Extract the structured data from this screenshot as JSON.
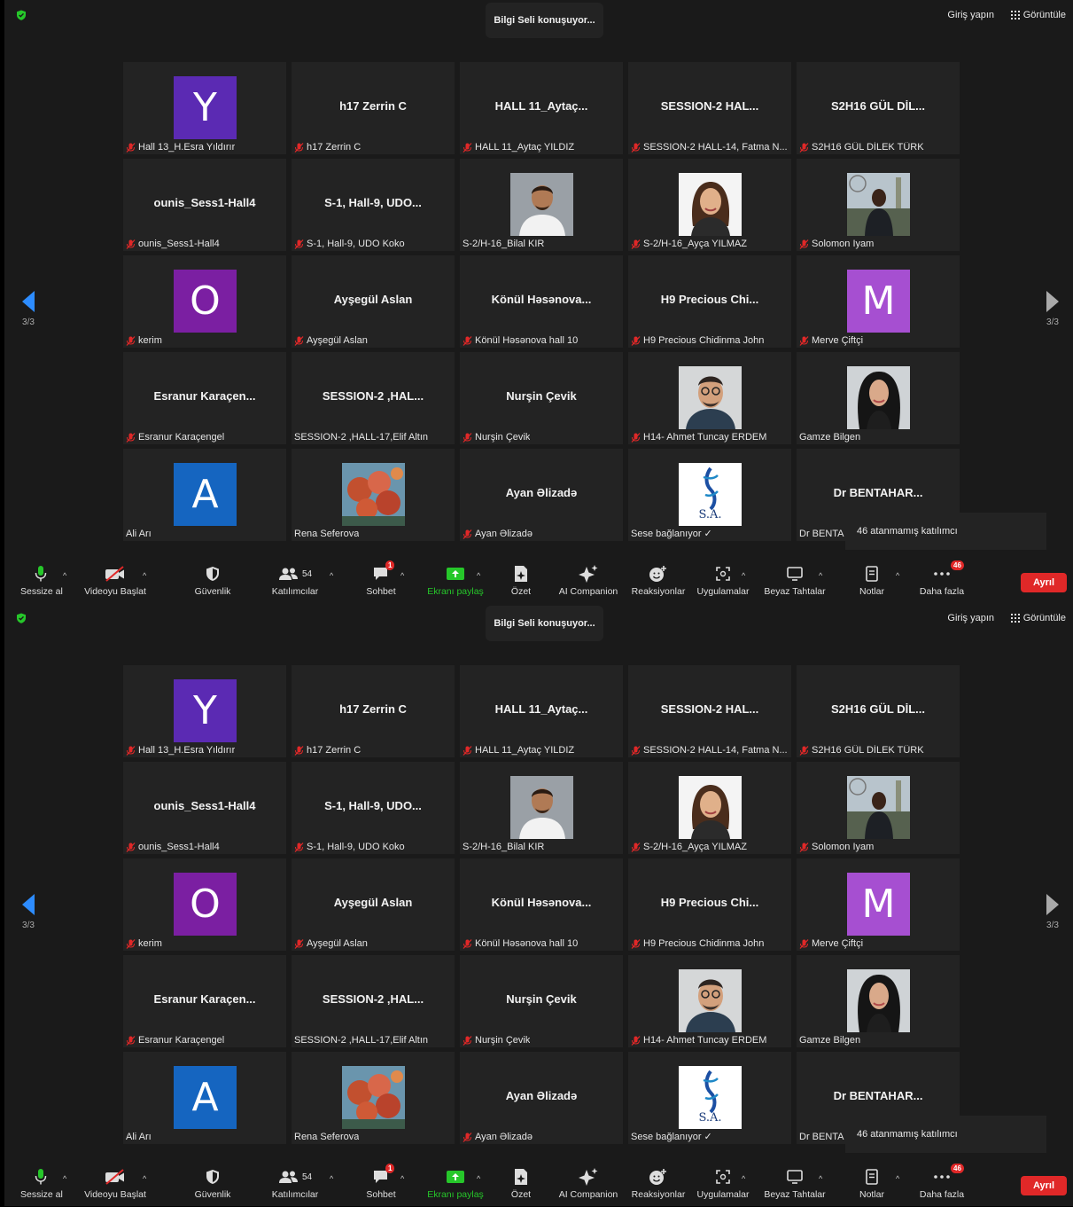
{
  "top": {
    "speaking": "Bilgi Seli konuşuyor...",
    "signin": "Giriş yapın",
    "view": "Görüntüle",
    "page": "3/3"
  },
  "tiles": [
    {
      "big": "",
      "avatar": "Y",
      "avatar_color": "#5b2ab3",
      "name": "Hall 13_H.Esra Yıldırır",
      "muted": true
    },
    {
      "big": "h17 Zerrin C",
      "name": "h17 Zerrin C",
      "muted": true
    },
    {
      "big": "HALL 11_Aytaç...",
      "name": "HALL 11_Aytaç YILDIZ",
      "muted": true
    },
    {
      "big": "SESSION-2  HAL...",
      "name": "SESSION-2 HALL-14, Fatma N...",
      "muted": true
    },
    {
      "big": "S2H16  GÜL DİL...",
      "name": "S2H16  GÜL DİLEK TÜRK",
      "muted": true
    },
    {
      "big": "ounis_Sess1-Hall4",
      "name": "ounis_Sess1-Hall4",
      "muted": true
    },
    {
      "big": "S-1,  Hall-9,  UDO...",
      "name": "S-1, Hall-9, UDO Koko",
      "muted": true
    },
    {
      "big": "",
      "photo": "man-grey",
      "name": "S-2/H-16_Bilal KIR",
      "muted": false
    },
    {
      "big": "",
      "photo": "woman-white",
      "name": "S-2/H-16_Ayça YILMAZ",
      "muted": true
    },
    {
      "big": "",
      "photo": "man-outdoor",
      "name": "Solomon Iyam",
      "muted": true
    },
    {
      "big": "",
      "avatar": "O",
      "avatar_color": "#7b1fa2",
      "name": "kerim",
      "muted": true
    },
    {
      "big": "Ayşegül Aslan",
      "name": "Ayşegül Aslan",
      "muted": true
    },
    {
      "big": "Könül  Həsənova...",
      "name": "Könül Həsənova hall 10",
      "muted": true
    },
    {
      "big": "H9  Precious   Chi...",
      "name": "H9 Precious  Chidinma John",
      "muted": true
    },
    {
      "big": "",
      "avatar": "M",
      "avatar_color": "#a64fd1",
      "name": "Merve Çiftçi",
      "muted": true
    },
    {
      "big": "Esranur  Karaçen...",
      "name": "Esranur Karaçengel",
      "muted": true
    },
    {
      "big": "SESSION-2  ,HAL...",
      "name": "SESSION-2 ,HALL-17,Elif Altın",
      "muted": false
    },
    {
      "big": "Nurşin Çevik",
      "name": "Nurşin Çevik",
      "muted": true
    },
    {
      "big": "",
      "photo": "man-glasses",
      "name": "H14- Ahmet Tuncay ERDEM",
      "muted": true
    },
    {
      "big": "",
      "photo": "woman-dark",
      "name": "Gamze Bilgen",
      "muted": false
    },
    {
      "big": "",
      "avatar": "A",
      "avatar_color": "#1565c0",
      "name": "Ali Arı",
      "muted": false
    },
    {
      "big": "",
      "photo": "flowers",
      "name": "Rena Seferova",
      "muted": false
    },
    {
      "big": "Ayan Əlizadə",
      "name": "Ayan Əlizadə",
      "muted": true
    },
    {
      "big": "",
      "photo": "sa-logo",
      "logo_text": "S.A.",
      "name": "Sese bağlanıyor ✓",
      "muted": false
    },
    {
      "big": "Dr BENTAHAR...",
      "name": "Dr BENTA",
      "muted": false
    }
  ],
  "popup": "46 atanmamış katılımcı",
  "toolbar": {
    "mute": "Sessize al",
    "video": "Videoyu Başlat",
    "security": "Güvenlik",
    "participants": "Katılımcılar",
    "participants_count": "54",
    "chat": "Sohbet",
    "chat_badge": "1",
    "share": "Ekranı paylaş",
    "summary": "Özet",
    "ai": "AI Companion",
    "reactions": "Reaksiyonlar",
    "apps": "Uygulamalar",
    "whiteboards": "Beyaz Tahtalar",
    "notes": "Notlar",
    "more": "Daha fazla",
    "more_badge": "46",
    "leave": "Ayrıl"
  },
  "colors": {
    "share_green": "#26c72a",
    "leave_red": "#e02828",
    "nav_blue": "#2d8cff",
    "tile_bg": "#232323"
  }
}
